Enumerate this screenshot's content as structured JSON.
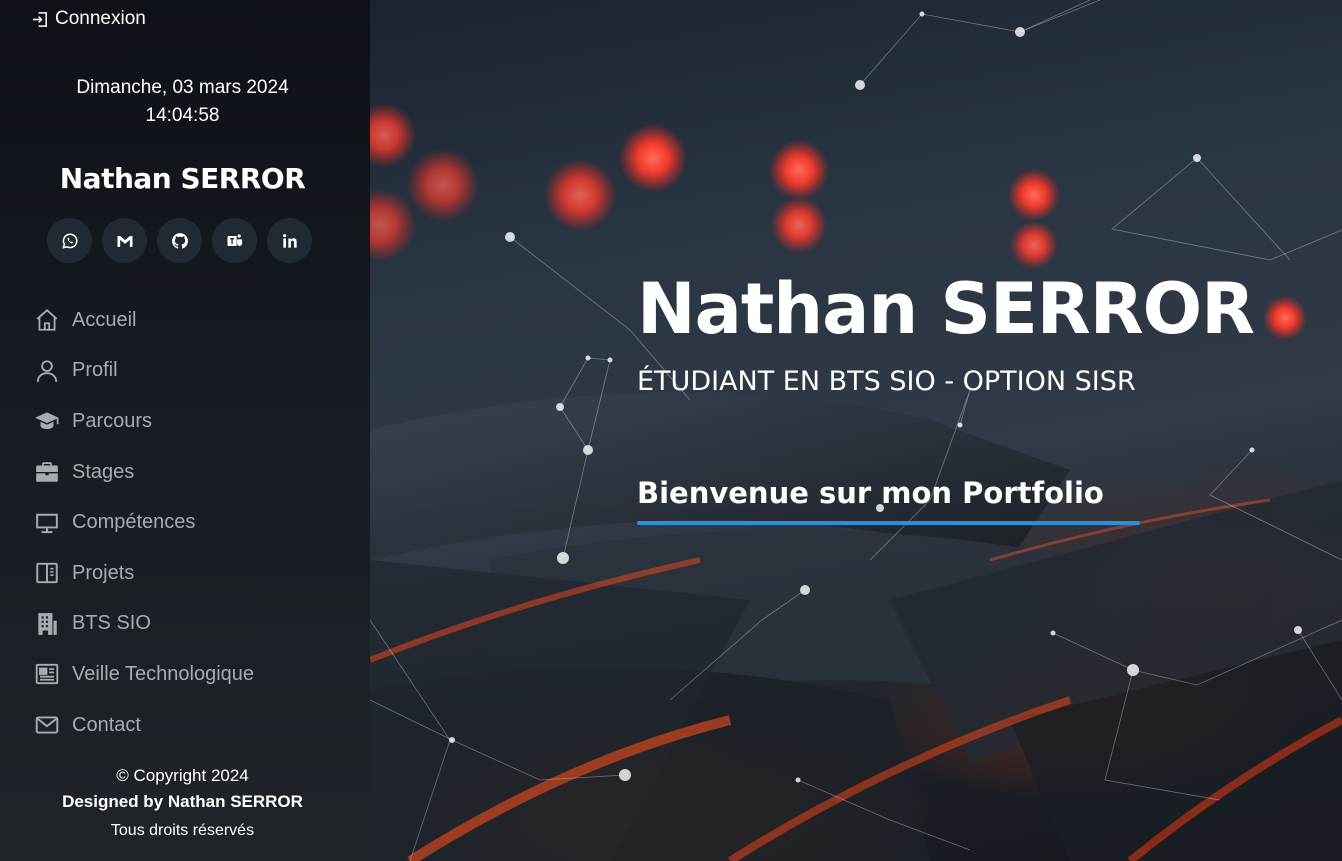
{
  "sidebar": {
    "login_label": "Connexion",
    "date": "Dimanche, 03 mars 2024",
    "time": "14:04:58",
    "name": "Nathan SERROR",
    "socials": [
      {
        "icon": "whatsapp-icon"
      },
      {
        "icon": "gmail-icon"
      },
      {
        "icon": "github-icon"
      },
      {
        "icon": "teams-icon"
      },
      {
        "icon": "linkedin-icon"
      }
    ],
    "nav": [
      {
        "label": "Accueil",
        "icon": "home-icon"
      },
      {
        "label": "Profil",
        "icon": "user-icon"
      },
      {
        "label": "Parcours",
        "icon": "graduation-cap-icon"
      },
      {
        "label": "Stages",
        "icon": "briefcase-icon"
      },
      {
        "label": "Compétences",
        "icon": "monitor-icon"
      },
      {
        "label": "Projets",
        "icon": "layout-icon"
      },
      {
        "label": "BTS SIO",
        "icon": "building-icon"
      },
      {
        "label": "Veille Technologique",
        "icon": "newspaper-icon"
      },
      {
        "label": "Contact",
        "icon": "envelope-icon"
      }
    ],
    "footer": {
      "copyright": "© Copyright 2024",
      "designed_by": "Designed by Nathan SERROR",
      "rights": "Tous droits réservés"
    }
  },
  "hero": {
    "title": "Nathan SERROR",
    "subtitle": "ÉTUDIANT EN BTS SIO - OPTION SISR",
    "welcome": "Bienvenue sur mon Portfolio",
    "accent_color": "#2a8fd8"
  },
  "colors": {
    "sidebar_bg": "#161b21",
    "nav_text": "#a8abb0",
    "social_bg": "#212a33"
  }
}
